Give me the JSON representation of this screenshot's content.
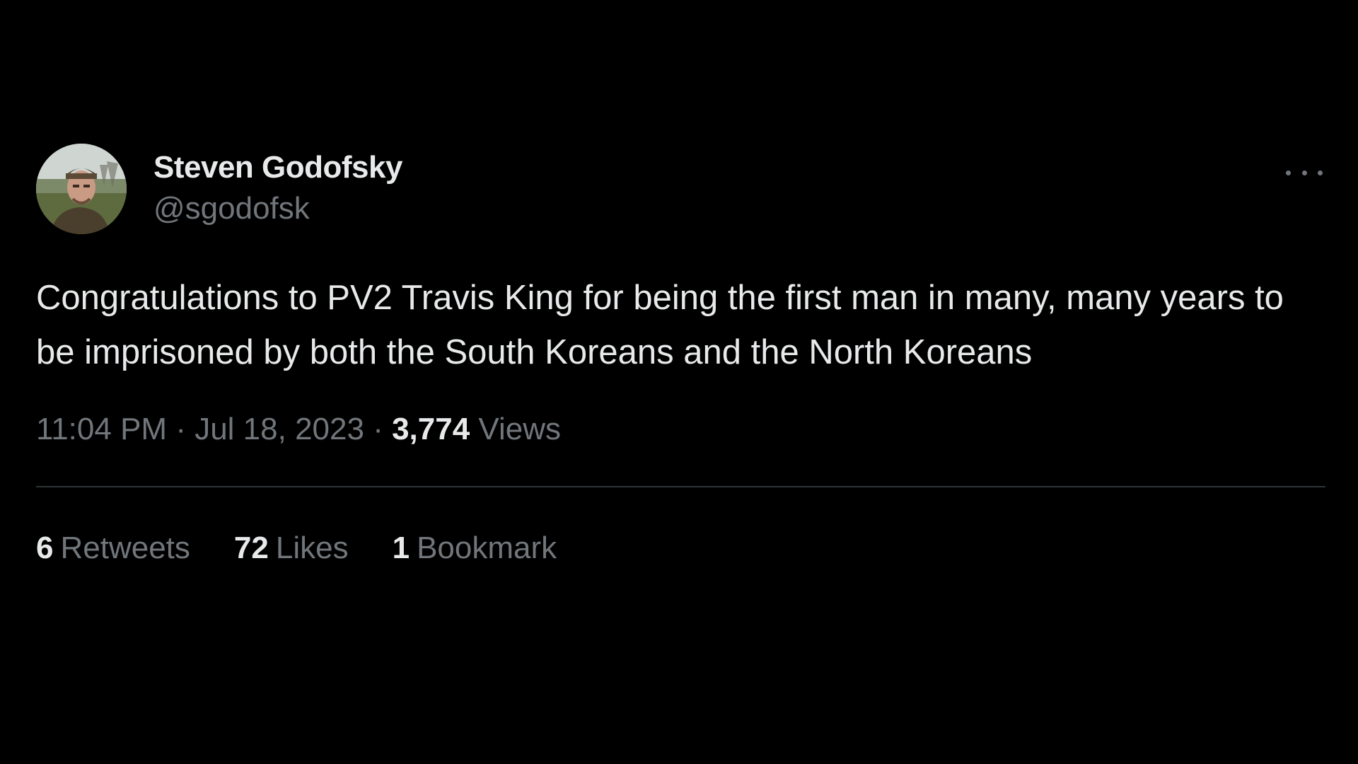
{
  "author": {
    "display_name": "Steven Godofsky",
    "handle": "@sgodofsk"
  },
  "tweet": {
    "text": "Congratulations to PV2 Travis King for being the first man in many, many years to be imprisoned by both the South Koreans and the North Koreans",
    "time": "11:04 PM",
    "date": "Jul 18, 2023",
    "separator": "·",
    "views_count": "3,774",
    "views_label": "Views"
  },
  "stats": [
    {
      "count": "6",
      "label": "Retweets"
    },
    {
      "count": "72",
      "label": "Likes"
    },
    {
      "count": "1",
      "label": "Bookmark"
    }
  ],
  "icons": {
    "more": "more-horizontal-icon",
    "avatar": "profile-photo"
  },
  "colors": {
    "background": "#000000",
    "primary_text": "#e7e9ea",
    "secondary_text": "#71767b",
    "divider": "#2f3336"
  }
}
